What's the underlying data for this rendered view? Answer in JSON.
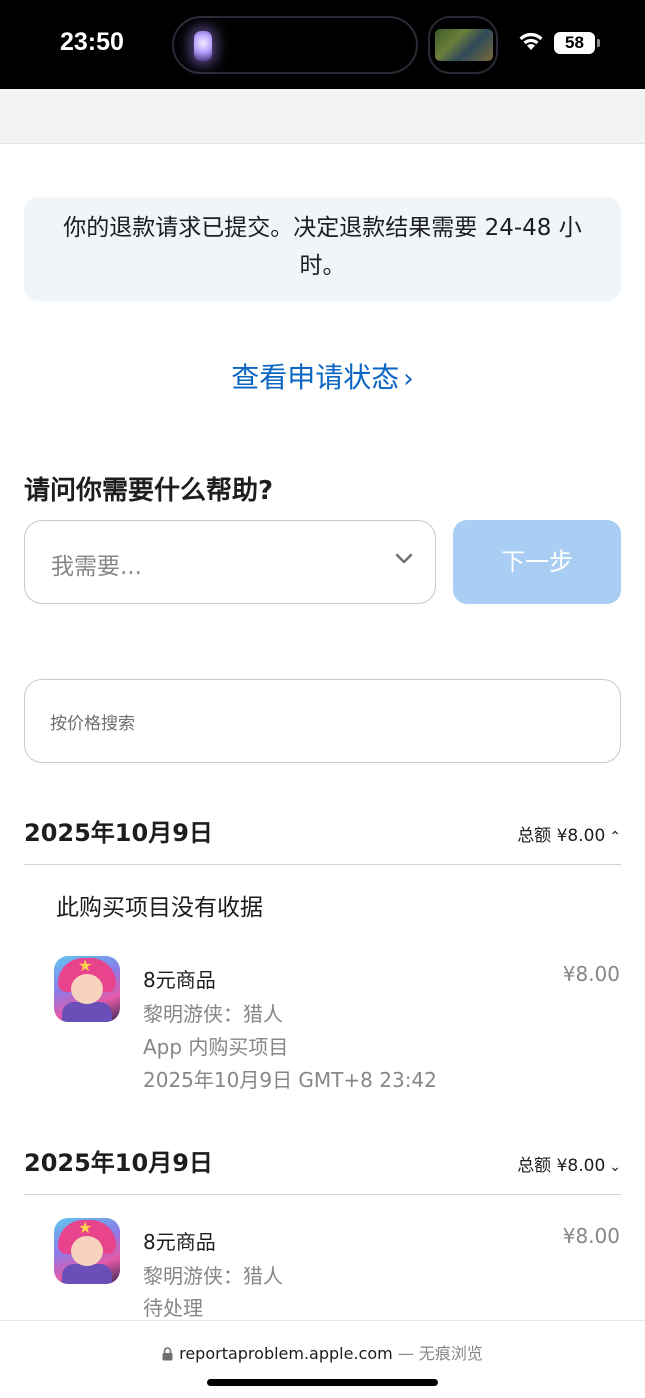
{
  "status_bar": {
    "time": "23:50",
    "battery": "58"
  },
  "notice": {
    "text": "你的退款请求已提交。决定退款结果需要 24-48 小时。"
  },
  "status_link": {
    "label": "查看申请状态",
    "chevron": "›"
  },
  "help": {
    "title": "请问你需要什么帮助?",
    "select_placeholder": "我需要...",
    "next_label": "下一步"
  },
  "search": {
    "placeholder": "按价格搜索"
  },
  "groups": [
    {
      "date": "2025年10月9日",
      "total": "总额 ¥8.00",
      "chevron": "⌃",
      "no_receipt": "此购买项目没有收据",
      "item": {
        "title": "8元商品",
        "app": "黎明游侠：猎人",
        "type": "App 内购买项目",
        "time": "2025年10月9日 GMT+8 23:42",
        "price": "¥8.00"
      }
    },
    {
      "date": "2025年10月9日",
      "total": "总额 ¥8.00",
      "chevron": "⌄",
      "item": {
        "title": "8元商品",
        "app": "黎明游侠：猎人",
        "status": "待处理",
        "price": "¥8.00"
      }
    }
  ],
  "bottom_bar": {
    "url": "reportaproblem.apple.com",
    "mode": "— 无痕浏览"
  },
  "colors": {
    "accent": "#0a66c2",
    "button_disabled": "#a9cdf3",
    "notice_bg": "#f0f5fa"
  }
}
